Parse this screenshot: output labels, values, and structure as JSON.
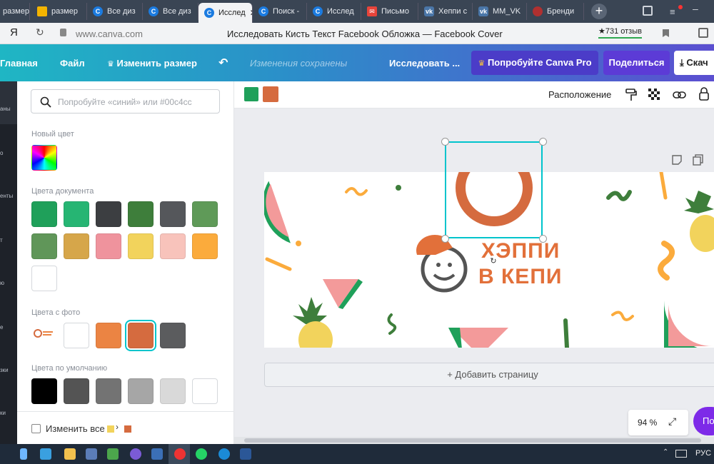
{
  "browser": {
    "tabs": [
      {
        "label": "размер"
      },
      {
        "label": "Все диз"
      },
      {
        "label": "Все диз"
      },
      {
        "label": "Исслед"
      },
      {
        "label": "Поиск -"
      },
      {
        "label": "Исслед"
      },
      {
        "label": "Письмо"
      },
      {
        "label": "Хеппи с"
      },
      {
        "label": "MM_VK"
      },
      {
        "label": "Бренди"
      }
    ],
    "active_tab": 3,
    "logo": "Я",
    "address": "www.canva.com",
    "page_title": "Исследовать Кисть Текст Facebook Обложка — Facebook Cover",
    "reviews": "★731 отзыв"
  },
  "toolbar": {
    "home": "Главная",
    "file": "Файл",
    "resize": "Изменить размер",
    "saved": "Изменения сохранены",
    "explore": "Исследовать ...",
    "pro": "Попробуйте Canva Pro",
    "share": "Поделиться",
    "download": "Скач"
  },
  "rail": {
    "items": [
      "аны",
      "о",
      "енты",
      "т",
      "ю",
      "е",
      "зки",
      "ки"
    ]
  },
  "panel": {
    "search_placeholder": "Попробуйте «синий» или #00c4cc",
    "new_color_label": "Новый цвет",
    "document_colors_label": "Цвета документа",
    "document_colors": [
      "#1fa05a",
      "#26b573",
      "#3c3e41",
      "#3e7e3b",
      "#55575b",
      "#5f9a58",
      "#609659",
      "#d6a64a",
      "#ef939d",
      "#f2d35c",
      "#f8c3bb",
      "#fbab3c",
      "#ffffff"
    ],
    "photo_colors_label": "Цвета с фото",
    "photo_colors": [
      "#ffffff",
      "#eb8443",
      "#d56b3f",
      "#5b5c5e"
    ],
    "default_colors_label": "Цвета по умолчанию",
    "default_colors": [
      "#000000",
      "#545454",
      "#737373",
      "#a6a6a6",
      "#d9d9d9",
      "#ffffff"
    ],
    "change_all": "Изменить все",
    "change_from": "#f2d35c",
    "change_to": "#d56b3f"
  },
  "editor": {
    "current_colors": [
      "#1fa05a",
      "#d56b3f"
    ],
    "arrange": "Расположение",
    "cover_text_line1": "ХЭППИ",
    "cover_text_line2": "В КЕПИ",
    "add_page": "+ Добавить страницу",
    "zoom": "94 %",
    "help": "По"
  },
  "taskbar": {
    "lang": "РУС"
  },
  "colors": {
    "accent": "#7d2ae8",
    "selection": "#00c4cc",
    "orange": "#e2703a"
  }
}
